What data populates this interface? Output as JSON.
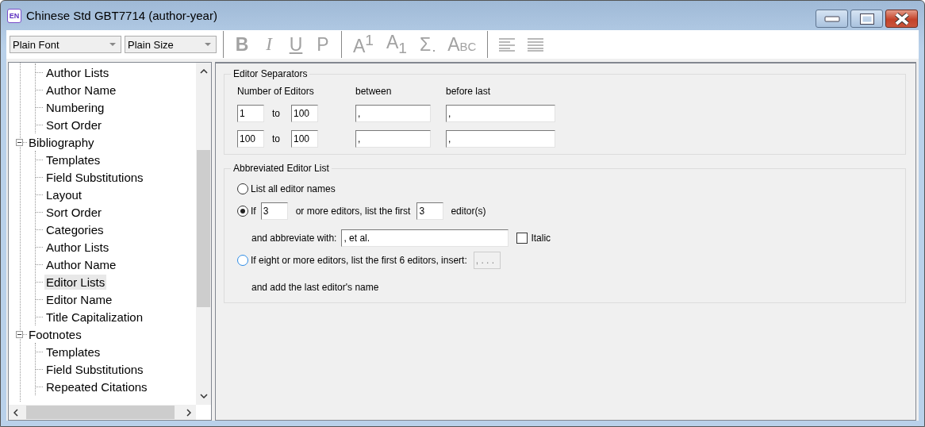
{
  "window": {
    "title": "Chinese Std GBT7714 (author-year)",
    "badge": "EN"
  },
  "toolbar": {
    "font": "Plain Font",
    "size": "Plain Size",
    "buttons": [
      {
        "kind": "bold",
        "label": "B",
        "disabled": true
      },
      {
        "kind": "italic",
        "label": "I",
        "disabled": true
      },
      {
        "kind": "underline",
        "label": "U",
        "disabled": true
      },
      {
        "kind": "plain",
        "label": "P",
        "disabled": true
      },
      {
        "kind": "sep"
      },
      {
        "kind": "super",
        "label": "A$^{1}$",
        "disabled": true
      },
      {
        "kind": "sub",
        "label": "A$_{1}$",
        "disabled": true
      },
      {
        "kind": "symbol",
        "label": "Σ",
        "disabled": true
      },
      {
        "kind": "smallcaps",
        "label": "ABC",
        "disabled": true
      },
      {
        "kind": "sep"
      },
      {
        "kind": "align-left",
        "disabled": true
      },
      {
        "kind": "justify",
        "disabled": true
      }
    ]
  },
  "tree": {
    "continued_children": [
      {
        "label": "Author Lists",
        "selected": false
      },
      {
        "label": "Author Name",
        "selected": false
      },
      {
        "label": "Numbering",
        "selected": false
      },
      {
        "label": "Sort Order",
        "selected": false
      }
    ],
    "nodes": [
      {
        "label": "Bibliography",
        "expanded": true,
        "selected": false,
        "children": [
          {
            "label": "Templates",
            "selected": false
          },
          {
            "label": "Field Substitutions",
            "selected": false
          },
          {
            "label": "Layout",
            "selected": false
          },
          {
            "label": "Sort Order",
            "selected": false
          },
          {
            "label": "Categories",
            "selected": false
          },
          {
            "label": "Author Lists",
            "selected": false
          },
          {
            "label": "Author Name",
            "selected": false
          },
          {
            "label": "Editor Lists",
            "selected": true
          },
          {
            "label": "Editor Name",
            "selected": false
          },
          {
            "label": "Title Capitalization",
            "selected": false
          }
        ]
      },
      {
        "label": "Footnotes",
        "expanded": true,
        "selected": false,
        "children": [
          {
            "label": "Templates",
            "selected": false
          },
          {
            "label": "Field Substitutions",
            "selected": false
          },
          {
            "label": "Repeated Citations",
            "selected": false
          }
        ]
      }
    ]
  },
  "editor_separators": {
    "title": "Editor Separators",
    "headers": [
      "Number of Editors",
      "between",
      "before last"
    ],
    "rows": [
      {
        "from": "1",
        "to_label": "to",
        "to": "100",
        "between": ",",
        "before_last": ","
      },
      {
        "from": "100",
        "to_label": "to",
        "to": "100",
        "between": ",",
        "before_last": ","
      }
    ]
  },
  "abbreviated": {
    "title": "Abbreviated Editor List",
    "options": [
      {
        "kind": "simple",
        "selected": false,
        "label": "List all editor names"
      },
      {
        "kind": "first",
        "selected": true,
        "label": "If",
        "min": "3",
        "mid": "or more editors, list the first",
        "count": "3",
        "suffix": "editor(s)",
        "abbrev_label": "and abbreviate with:",
        "abbrev": ", et al.",
        "italic_label": "Italic",
        "italic": false
      },
      {
        "kind": "insert",
        "selected": false,
        "label": "If eight or more editors, list the first 6 editors, insert:",
        "insert": ", . . .",
        "insert_disabled": true,
        "note": "and add the last editor's name"
      }
    ]
  }
}
